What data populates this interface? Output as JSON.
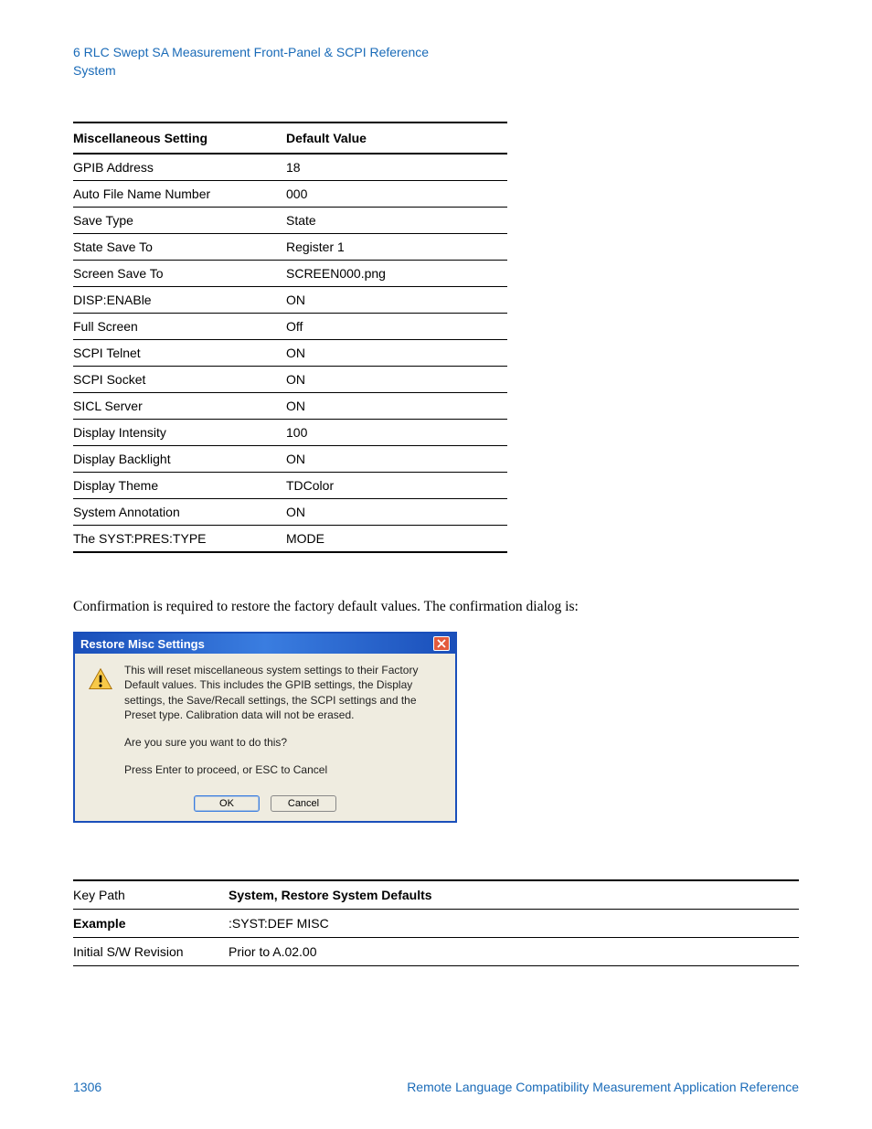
{
  "header": {
    "line1": "6  RLC Swept SA Measurement Front-Panel & SCPI Reference",
    "line2": "System"
  },
  "settings_table": {
    "headers": {
      "setting": "Miscellaneous Setting",
      "value": "Default Value"
    },
    "rows": [
      {
        "setting": "GPIB Address",
        "value": "18"
      },
      {
        "setting": "Auto File Name Number",
        "value": "000"
      },
      {
        "setting": "Save Type",
        "value": "State"
      },
      {
        "setting": "State Save To",
        "value": "Register 1"
      },
      {
        "setting": "Screen Save To",
        "value": "SCREEN000.png"
      },
      {
        "setting": "DISP:ENABle",
        "value": "ON"
      },
      {
        "setting": "Full Screen",
        "value": "Off"
      },
      {
        "setting": "SCPI Telnet",
        "value": "ON"
      },
      {
        "setting": "SCPI Socket",
        "value": "ON"
      },
      {
        "setting": "SICL Server",
        "value": "ON"
      },
      {
        "setting": "Display Intensity",
        "value": "100"
      },
      {
        "setting": "Display Backlight",
        "value": "ON"
      },
      {
        "setting": "Display Theme",
        "value": "TDColor"
      },
      {
        "setting": "System Annotation",
        "value": "ON"
      },
      {
        "setting": "The SYST:PRES:TYPE",
        "value": "MODE"
      }
    ]
  },
  "body_text": "Confirmation is required to restore the factory default values. The confirmation dialog is:",
  "dialog": {
    "title": "Restore Misc Settings",
    "para1": "This will reset miscellaneous system settings to their Factory Default values.   This includes the GPIB settings, the Display settings, the Save/Recall settings, the SCPI settings and the Preset type. Calibration data will not be erased.",
    "para2": "Are you sure you want to do this?",
    "para3": "Press Enter to proceed, or ESC to Cancel",
    "ok": "OK",
    "cancel": "Cancel"
  },
  "ref_table": {
    "rows": [
      {
        "label": "Key Path",
        "label_bold": false,
        "value": "System, Restore System Defaults",
        "value_bold": true
      },
      {
        "label": "Example",
        "label_bold": true,
        "value": ":SYST:DEF MISC",
        "value_bold": false
      },
      {
        "label": "Initial S/W Revision",
        "label_bold": false,
        "value": "Prior to A.02.00",
        "value_bold": false
      }
    ]
  },
  "footer": {
    "page": "1306",
    "title": "Remote Language Compatibility Measurement Application Reference"
  },
  "chart_data": {
    "type": "table",
    "title": "Miscellaneous Setting Defaults",
    "columns": [
      "Miscellaneous Setting",
      "Default Value"
    ],
    "rows": [
      [
        "GPIB Address",
        "18"
      ],
      [
        "Auto File Name Number",
        "000"
      ],
      [
        "Save Type",
        "State"
      ],
      [
        "State Save To",
        "Register 1"
      ],
      [
        "Screen Save To",
        "SCREEN000.png"
      ],
      [
        "DISP:ENABle",
        "ON"
      ],
      [
        "Full Screen",
        "Off"
      ],
      [
        "SCPI Telnet",
        "ON"
      ],
      [
        "SCPI Socket",
        "ON"
      ],
      [
        "SICL Server",
        "ON"
      ],
      [
        "Display Intensity",
        "100"
      ],
      [
        "Display Backlight",
        "ON"
      ],
      [
        "Display Theme",
        "TDColor"
      ],
      [
        "System Annotation",
        "ON"
      ],
      [
        "The SYST:PRES:TYPE",
        "MODE"
      ]
    ]
  }
}
